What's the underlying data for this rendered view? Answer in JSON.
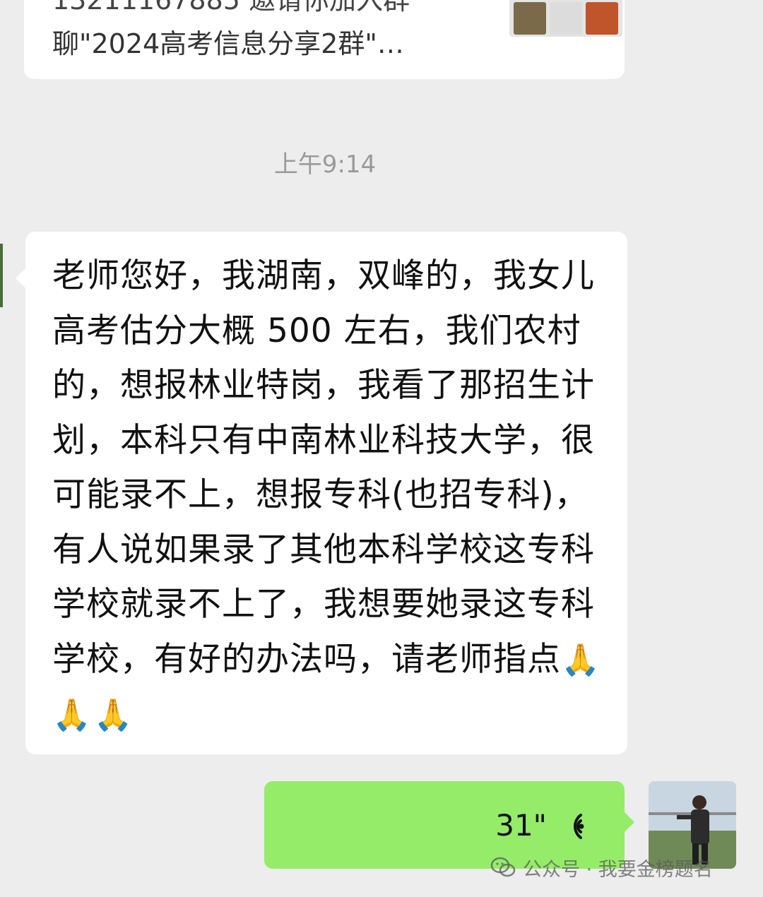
{
  "invite": {
    "line1": "13211167885 邀请你加入群",
    "line2": "聊\"2024高考信息分享2群\"…"
  },
  "timestamp": "上午9:14",
  "incoming_message": {
    "text": "老师您好，我湖南，双峰的，我女儿高考估分大概 500 左右，我们农村的，想报林业特岗，我看了那招生计划，本科只有中南林业科技大学，很可能录不上，想报专科(也招专科)，有人说如果录了其他本科学校这专科学校就录不上了，我想要她录这专科学校，有好的办法吗，请老师指点",
    "emoji": "🙏🙏🙏"
  },
  "outgoing_voice": {
    "duration": "31\""
  },
  "watermark": {
    "text": "公众号 · 我要金榜题名"
  },
  "icons": {
    "voice": "voice-wave-icon",
    "watermark": "wechat-icon"
  },
  "colors": {
    "background": "#ededed",
    "incoming_bubble": "#ffffff",
    "outgoing_bubble": "#95ec69",
    "timestamp": "#9a9a9a"
  }
}
